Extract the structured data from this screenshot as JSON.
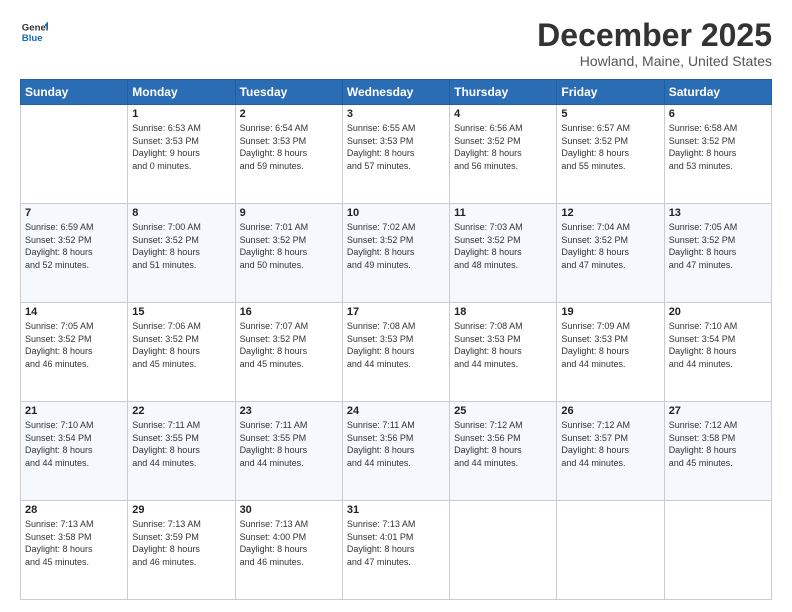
{
  "logo": {
    "line1": "General",
    "line2": "Blue"
  },
  "header": {
    "title": "December 2025",
    "subtitle": "Howland, Maine, United States"
  },
  "days_of_week": [
    "Sunday",
    "Monday",
    "Tuesday",
    "Wednesday",
    "Thursday",
    "Friday",
    "Saturday"
  ],
  "weeks": [
    [
      {
        "day": "",
        "info": ""
      },
      {
        "day": "1",
        "info": "Sunrise: 6:53 AM\nSunset: 3:53 PM\nDaylight: 9 hours\nand 0 minutes."
      },
      {
        "day": "2",
        "info": "Sunrise: 6:54 AM\nSunset: 3:53 PM\nDaylight: 8 hours\nand 59 minutes."
      },
      {
        "day": "3",
        "info": "Sunrise: 6:55 AM\nSunset: 3:53 PM\nDaylight: 8 hours\nand 57 minutes."
      },
      {
        "day": "4",
        "info": "Sunrise: 6:56 AM\nSunset: 3:52 PM\nDaylight: 8 hours\nand 56 minutes."
      },
      {
        "day": "5",
        "info": "Sunrise: 6:57 AM\nSunset: 3:52 PM\nDaylight: 8 hours\nand 55 minutes."
      },
      {
        "day": "6",
        "info": "Sunrise: 6:58 AM\nSunset: 3:52 PM\nDaylight: 8 hours\nand 53 minutes."
      }
    ],
    [
      {
        "day": "7",
        "info": "Sunrise: 6:59 AM\nSunset: 3:52 PM\nDaylight: 8 hours\nand 52 minutes."
      },
      {
        "day": "8",
        "info": "Sunrise: 7:00 AM\nSunset: 3:52 PM\nDaylight: 8 hours\nand 51 minutes."
      },
      {
        "day": "9",
        "info": "Sunrise: 7:01 AM\nSunset: 3:52 PM\nDaylight: 8 hours\nand 50 minutes."
      },
      {
        "day": "10",
        "info": "Sunrise: 7:02 AM\nSunset: 3:52 PM\nDaylight: 8 hours\nand 49 minutes."
      },
      {
        "day": "11",
        "info": "Sunrise: 7:03 AM\nSunset: 3:52 PM\nDaylight: 8 hours\nand 48 minutes."
      },
      {
        "day": "12",
        "info": "Sunrise: 7:04 AM\nSunset: 3:52 PM\nDaylight: 8 hours\nand 47 minutes."
      },
      {
        "day": "13",
        "info": "Sunrise: 7:05 AM\nSunset: 3:52 PM\nDaylight: 8 hours\nand 47 minutes."
      }
    ],
    [
      {
        "day": "14",
        "info": "Sunrise: 7:05 AM\nSunset: 3:52 PM\nDaylight: 8 hours\nand 46 minutes."
      },
      {
        "day": "15",
        "info": "Sunrise: 7:06 AM\nSunset: 3:52 PM\nDaylight: 8 hours\nand 45 minutes."
      },
      {
        "day": "16",
        "info": "Sunrise: 7:07 AM\nSunset: 3:52 PM\nDaylight: 8 hours\nand 45 minutes."
      },
      {
        "day": "17",
        "info": "Sunrise: 7:08 AM\nSunset: 3:53 PM\nDaylight: 8 hours\nand 44 minutes."
      },
      {
        "day": "18",
        "info": "Sunrise: 7:08 AM\nSunset: 3:53 PM\nDaylight: 8 hours\nand 44 minutes."
      },
      {
        "day": "19",
        "info": "Sunrise: 7:09 AM\nSunset: 3:53 PM\nDaylight: 8 hours\nand 44 minutes."
      },
      {
        "day": "20",
        "info": "Sunrise: 7:10 AM\nSunset: 3:54 PM\nDaylight: 8 hours\nand 44 minutes."
      }
    ],
    [
      {
        "day": "21",
        "info": "Sunrise: 7:10 AM\nSunset: 3:54 PM\nDaylight: 8 hours\nand 44 minutes."
      },
      {
        "day": "22",
        "info": "Sunrise: 7:11 AM\nSunset: 3:55 PM\nDaylight: 8 hours\nand 44 minutes."
      },
      {
        "day": "23",
        "info": "Sunrise: 7:11 AM\nSunset: 3:55 PM\nDaylight: 8 hours\nand 44 minutes."
      },
      {
        "day": "24",
        "info": "Sunrise: 7:11 AM\nSunset: 3:56 PM\nDaylight: 8 hours\nand 44 minutes."
      },
      {
        "day": "25",
        "info": "Sunrise: 7:12 AM\nSunset: 3:56 PM\nDaylight: 8 hours\nand 44 minutes."
      },
      {
        "day": "26",
        "info": "Sunrise: 7:12 AM\nSunset: 3:57 PM\nDaylight: 8 hours\nand 44 minutes."
      },
      {
        "day": "27",
        "info": "Sunrise: 7:12 AM\nSunset: 3:58 PM\nDaylight: 8 hours\nand 45 minutes."
      }
    ],
    [
      {
        "day": "28",
        "info": "Sunrise: 7:13 AM\nSunset: 3:58 PM\nDaylight: 8 hours\nand 45 minutes."
      },
      {
        "day": "29",
        "info": "Sunrise: 7:13 AM\nSunset: 3:59 PM\nDaylight: 8 hours\nand 46 minutes."
      },
      {
        "day": "30",
        "info": "Sunrise: 7:13 AM\nSunset: 4:00 PM\nDaylight: 8 hours\nand 46 minutes."
      },
      {
        "day": "31",
        "info": "Sunrise: 7:13 AM\nSunset: 4:01 PM\nDaylight: 8 hours\nand 47 minutes."
      },
      {
        "day": "",
        "info": ""
      },
      {
        "day": "",
        "info": ""
      },
      {
        "day": "",
        "info": ""
      }
    ]
  ]
}
